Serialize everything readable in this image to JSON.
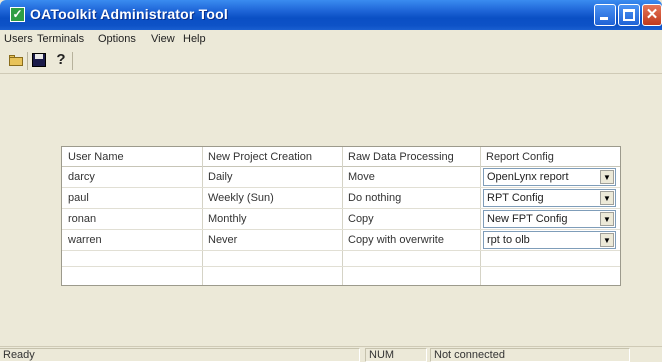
{
  "window": {
    "title": "OAToolkit Administrator Tool"
  },
  "menu": {
    "items": [
      {
        "label": "Users"
      },
      {
        "label": "Terminals"
      },
      {
        "label": "Options"
      },
      {
        "label": "View"
      },
      {
        "label": "Help"
      }
    ]
  },
  "toolbar": {
    "icons": [
      "open-folder-icon",
      "save-icon",
      "help-icon"
    ]
  },
  "grid": {
    "columns": [
      "User Name",
      "New Project Creation",
      "Raw Data Processing",
      "Report Config"
    ],
    "rows": [
      {
        "user": "darcy",
        "creation": "Daily",
        "processing": "Move",
        "report": "OpenLynx report"
      },
      {
        "user": "paul",
        "creation": "Weekly (Sun)",
        "processing": "Do nothing",
        "report": "RPT Config"
      },
      {
        "user": "ronan",
        "creation": "Monthly",
        "processing": "Copy",
        "report": "New FPT Config"
      },
      {
        "user": "warren",
        "creation": "Never",
        "processing": "Copy with overwrite",
        "report": "rpt to olb"
      }
    ]
  },
  "status": {
    "text": "Ready",
    "num": "NUM",
    "connection": "Not connected"
  }
}
